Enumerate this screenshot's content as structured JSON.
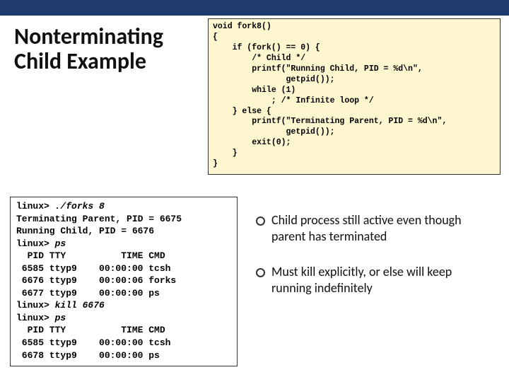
{
  "title": "Nonterminating Child Example",
  "code": "void fork8()\n{\n    if (fork() == 0) {\n        /* Child */\n        printf(\"Running Child, PID = %d\\n\",\n               getpid());\n        while (1)\n            ; /* Infinite loop */\n    } else {\n        printf(\"Terminating Parent, PID = %d\\n\",\n               getpid());\n        exit(0);\n    }\n}",
  "terminal": {
    "l1p": "linux> ",
    "l1c": "./forks 8",
    "l2": "Terminating Parent, PID = 6675",
    "l3": "Running Child, PID = 6676",
    "l4p": "linux> ",
    "l4c": "ps",
    "l5": "  PID TTY          TIME CMD",
    "l6": " 6585 ttyp9    00:00:00 tcsh",
    "l7": " 6676 ttyp9    00:00:06 forks",
    "l8": " 6677 ttyp9    00:00:00 ps",
    "l9p": "linux> ",
    "l9c": "kill 6676",
    "l10p": "linux> ",
    "l10c": "ps",
    "l11": "  PID TTY          TIME CMD",
    "l12": " 6585 ttyp9    00:00:00 tcsh",
    "l13": " 6678 ttyp9    00:00:00 ps"
  },
  "bullets": {
    "b1": "Child process still active even though parent has terminated",
    "b2": "Must kill explicitly, or else will keep running indefinitely"
  }
}
